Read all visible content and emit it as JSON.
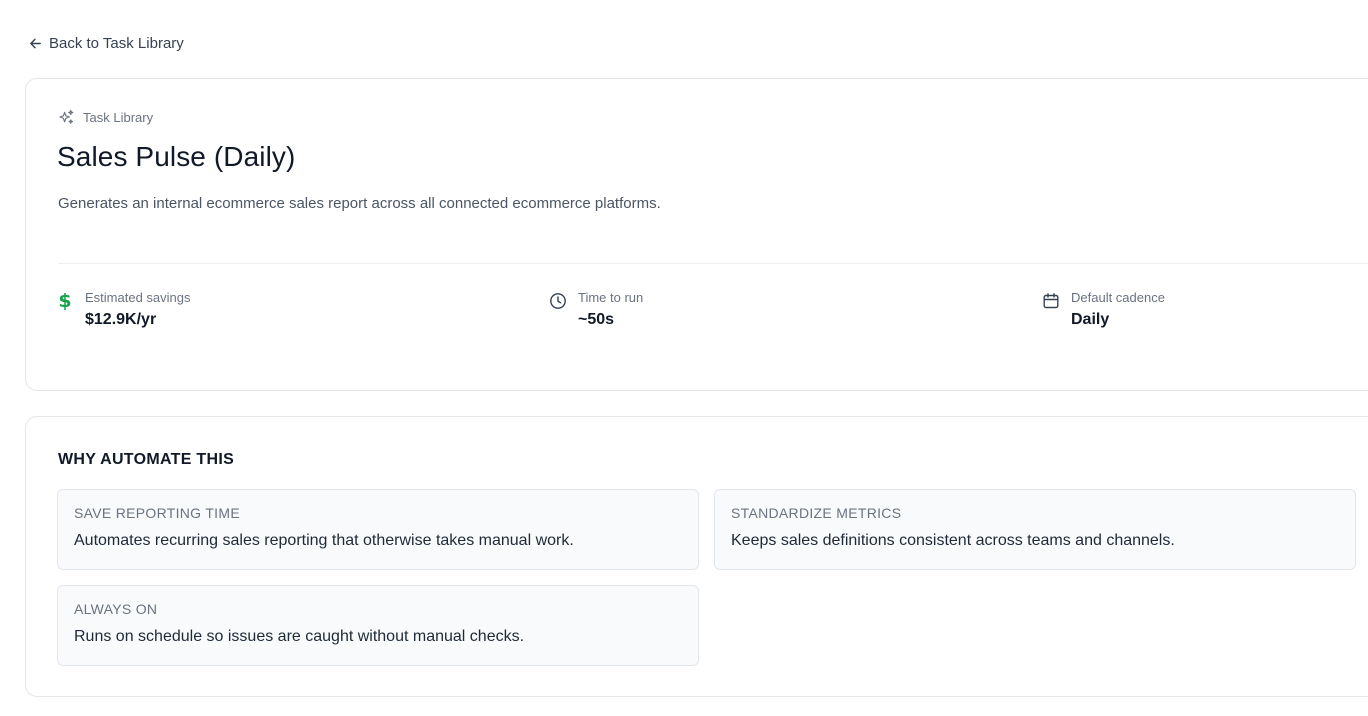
{
  "nav": {
    "back_label": "Back to Task Library"
  },
  "task": {
    "eyebrow": "Task Library",
    "title": "Sales Pulse (Daily)",
    "description": "Generates an internal ecommerce sales report across all connected ecommerce platforms."
  },
  "stats": [
    {
      "icon": "dollar-icon",
      "label": "Estimated savings",
      "value": "$12.9K/yr"
    },
    {
      "icon": "clock-icon",
      "label": "Time to run",
      "value": "~50s"
    },
    {
      "icon": "calendar-icon",
      "label": "Default cadence",
      "value": "Daily"
    }
  ],
  "why": {
    "heading": "WHY AUTOMATE THIS",
    "reasons": [
      {
        "title": "SAVE REPORTING TIME",
        "text": "Automates recurring sales reporting that otherwise takes manual work."
      },
      {
        "title": "STANDARDIZE METRICS",
        "text": "Keeps sales definitions consistent across teams and channels."
      },
      {
        "title": "ALWAYS ON",
        "text": "Runs on schedule so issues are caught without manual checks."
      }
    ]
  },
  "colors": {
    "accent_green": "#16a34a",
    "text": "#111827",
    "muted": "#6b7280",
    "border": "#e5e7eb",
    "tile_bg": "#f8fafc"
  }
}
